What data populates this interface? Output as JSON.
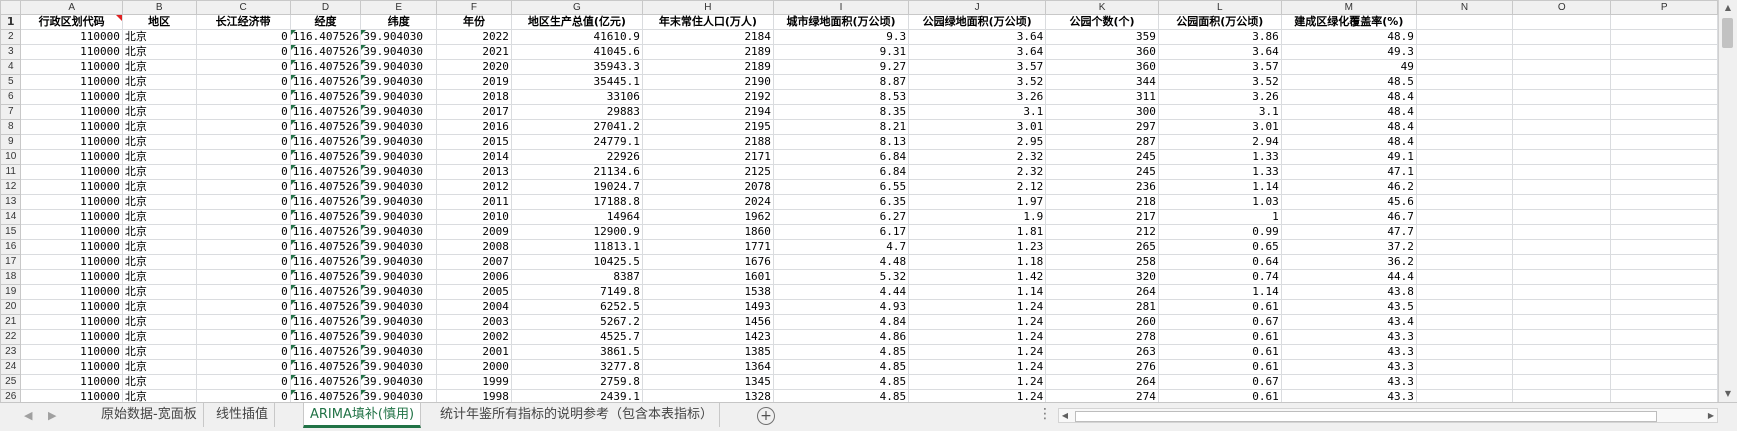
{
  "columns": [
    "A",
    "B",
    "C",
    "D",
    "E",
    "F",
    "G",
    "H",
    "I",
    "J",
    "K",
    "L",
    "M",
    "N",
    "O",
    "P"
  ],
  "headers": [
    "行政区划代码",
    "地区",
    "长江经济带",
    "经度",
    "纬度",
    "年份",
    "地区生产总值(亿元)",
    "年末常住人口(万人)",
    "城市绿地面积(万公顷)",
    "公园绿地面积(万公顷)",
    "公园个数(个)",
    "公园面积(万公顷)",
    "建成区绿化覆盖率(%)",
    "",
    "",
    ""
  ],
  "rows": [
    {
      "n": "2",
      "cells": [
        "110000",
        "北京",
        "0",
        "116.407526",
        "39.904030",
        "2022",
        "41610.9",
        "2184",
        "9.3",
        "3.64",
        "359",
        "3.86",
        "48.9"
      ]
    },
    {
      "n": "3",
      "cells": [
        "110000",
        "北京",
        "0",
        "116.407526",
        "39.904030",
        "2021",
        "41045.6",
        "2189",
        "9.31",
        "3.64",
        "360",
        "3.64",
        "49.3"
      ]
    },
    {
      "n": "4",
      "cells": [
        "110000",
        "北京",
        "0",
        "116.407526",
        "39.904030",
        "2020",
        "35943.3",
        "2189",
        "9.27",
        "3.57",
        "360",
        "3.57",
        "49"
      ]
    },
    {
      "n": "5",
      "cells": [
        "110000",
        "北京",
        "0",
        "116.407526",
        "39.904030",
        "2019",
        "35445.1",
        "2190",
        "8.87",
        "3.52",
        "344",
        "3.52",
        "48.5"
      ]
    },
    {
      "n": "6",
      "cells": [
        "110000",
        "北京",
        "0",
        "116.407526",
        "39.904030",
        "2018",
        "33106",
        "2192",
        "8.53",
        "3.26",
        "311",
        "3.26",
        "48.4"
      ]
    },
    {
      "n": "7",
      "cells": [
        "110000",
        "北京",
        "0",
        "116.407526",
        "39.904030",
        "2017",
        "29883",
        "2194",
        "8.35",
        "3.1",
        "300",
        "3.1",
        "48.4"
      ]
    },
    {
      "n": "8",
      "cells": [
        "110000",
        "北京",
        "0",
        "116.407526",
        "39.904030",
        "2016",
        "27041.2",
        "2195",
        "8.21",
        "3.01",
        "297",
        "3.01",
        "48.4"
      ]
    },
    {
      "n": "9",
      "cells": [
        "110000",
        "北京",
        "0",
        "116.407526",
        "39.904030",
        "2015",
        "24779.1",
        "2188",
        "8.13",
        "2.95",
        "287",
        "2.94",
        "48.4"
      ]
    },
    {
      "n": "10",
      "cells": [
        "110000",
        "北京",
        "0",
        "116.407526",
        "39.904030",
        "2014",
        "22926",
        "2171",
        "6.84",
        "2.32",
        "245",
        "1.33",
        "49.1"
      ]
    },
    {
      "n": "11",
      "cells": [
        "110000",
        "北京",
        "0",
        "116.407526",
        "39.904030",
        "2013",
        "21134.6",
        "2125",
        "6.84",
        "2.32",
        "245",
        "1.33",
        "47.1"
      ]
    },
    {
      "n": "12",
      "cells": [
        "110000",
        "北京",
        "0",
        "116.407526",
        "39.904030",
        "2012",
        "19024.7",
        "2078",
        "6.55",
        "2.12",
        "236",
        "1.14",
        "46.2"
      ]
    },
    {
      "n": "13",
      "cells": [
        "110000",
        "北京",
        "0",
        "116.407526",
        "39.904030",
        "2011",
        "17188.8",
        "2024",
        "6.35",
        "1.97",
        "218",
        "1.03",
        "45.6"
      ]
    },
    {
      "n": "14",
      "cells": [
        "110000",
        "北京",
        "0",
        "116.407526",
        "39.904030",
        "2010",
        "14964",
        "1962",
        "6.27",
        "1.9",
        "217",
        "1",
        "46.7"
      ]
    },
    {
      "n": "15",
      "cells": [
        "110000",
        "北京",
        "0",
        "116.407526",
        "39.904030",
        "2009",
        "12900.9",
        "1860",
        "6.17",
        "1.81",
        "212",
        "0.99",
        "47.7"
      ]
    },
    {
      "n": "16",
      "cells": [
        "110000",
        "北京",
        "0",
        "116.407526",
        "39.904030",
        "2008",
        "11813.1",
        "1771",
        "4.7",
        "1.23",
        "265",
        "0.65",
        "37.2"
      ]
    },
    {
      "n": "17",
      "cells": [
        "110000",
        "北京",
        "0",
        "116.407526",
        "39.904030",
        "2007",
        "10425.5",
        "1676",
        "4.48",
        "1.18",
        "258",
        "0.64",
        "36.2"
      ]
    },
    {
      "n": "18",
      "cells": [
        "110000",
        "北京",
        "0",
        "116.407526",
        "39.904030",
        "2006",
        "8387",
        "1601",
        "5.32",
        "1.42",
        "320",
        "0.74",
        "44.4"
      ]
    },
    {
      "n": "19",
      "cells": [
        "110000",
        "北京",
        "0",
        "116.407526",
        "39.904030",
        "2005",
        "7149.8",
        "1538",
        "4.44",
        "1.14",
        "264",
        "1.14",
        "43.8"
      ]
    },
    {
      "n": "20",
      "cells": [
        "110000",
        "北京",
        "0",
        "116.407526",
        "39.904030",
        "2004",
        "6252.5",
        "1493",
        "4.93",
        "1.24",
        "281",
        "0.61",
        "43.5"
      ]
    },
    {
      "n": "21",
      "cells": [
        "110000",
        "北京",
        "0",
        "116.407526",
        "39.904030",
        "2003",
        "5267.2",
        "1456",
        "4.84",
        "1.24",
        "260",
        "0.67",
        "43.4"
      ]
    },
    {
      "n": "22",
      "cells": [
        "110000",
        "北京",
        "0",
        "116.407526",
        "39.904030",
        "2002",
        "4525.7",
        "1423",
        "4.86",
        "1.24",
        "278",
        "0.61",
        "43.3"
      ]
    },
    {
      "n": "23",
      "cells": [
        "110000",
        "北京",
        "0",
        "116.407526",
        "39.904030",
        "2001",
        "3861.5",
        "1385",
        "4.85",
        "1.24",
        "263",
        "0.61",
        "43.3"
      ]
    },
    {
      "n": "24",
      "cells": [
        "110000",
        "北京",
        "0",
        "116.407526",
        "39.904030",
        "2000",
        "3277.8",
        "1364",
        "4.85",
        "1.24",
        "276",
        "0.61",
        "43.3"
      ]
    },
    {
      "n": "25",
      "cells": [
        "110000",
        "北京",
        "0",
        "116.407526",
        "39.904030",
        "1999",
        "2759.8",
        "1345",
        "4.85",
        "1.24",
        "264",
        "0.67",
        "43.3"
      ]
    },
    {
      "n": "26",
      "cells": [
        "110000",
        "北京",
        "0",
        "116.407526",
        "39.904030",
        "1998",
        "2439.1",
        "1328",
        "4.85",
        "1.24",
        "274",
        "0.61",
        "43.3"
      ]
    }
  ],
  "tabs": [
    "原始数据-宽面板",
    "线性插值",
    "ARIMA填补(慎用)",
    "统计年鉴所有指标的说明参考（包含本表指标）"
  ],
  "active_tab": 2,
  "tabbar": {
    "add_label": "+",
    "more_label": "⋮",
    "nav_prev": "◀",
    "nav_next": "▶"
  }
}
